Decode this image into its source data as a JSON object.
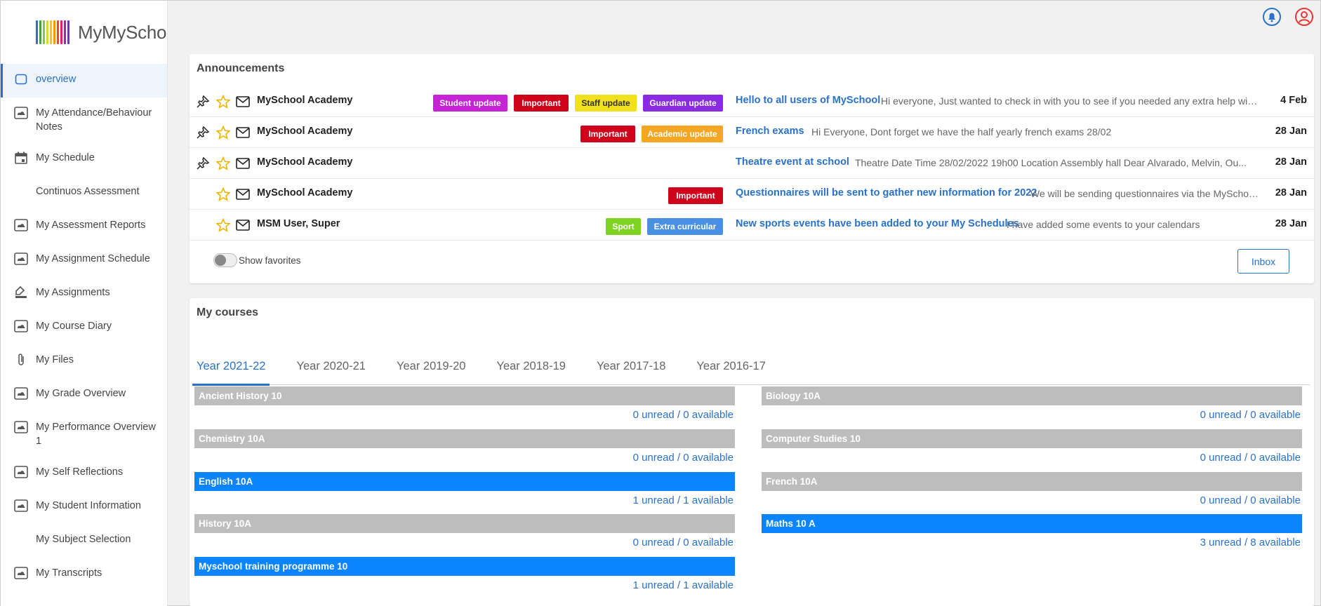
{
  "app": {
    "name": "MyMySchool",
    "logo_colors": [
      "#2a72c9",
      "#43a047",
      "#8bc34a",
      "#cddc39",
      "#ffc107",
      "#ff9800",
      "#f44336",
      "#e91e63",
      "#9c27b0",
      "#673ab7"
    ]
  },
  "sidebar": {
    "items": [
      {
        "label": "overview",
        "icon": "square-outline-icon",
        "active": true
      },
      {
        "label": "My Attendance/Behaviour Notes",
        "icon": "cloud-folder-icon"
      },
      {
        "label": "My Schedule",
        "icon": "calendar-icon"
      },
      {
        "label": "Continuos Assessment",
        "icon": ""
      },
      {
        "label": "My Assessment Reports",
        "icon": "cloud-folder-icon"
      },
      {
        "label": "My Assignment Schedule",
        "icon": "cloud-folder-icon"
      },
      {
        "label": "My Assignments",
        "icon": "pen-stamp-icon"
      },
      {
        "label": "My Course Diary",
        "icon": "cloud-folder-icon"
      },
      {
        "label": "My Files",
        "icon": "paperclip-icon"
      },
      {
        "label": "My Grade Overview",
        "icon": "cloud-folder-icon"
      },
      {
        "label": "My Performance Overview 1",
        "icon": "cloud-folder-icon"
      },
      {
        "label": "My Self Reflections",
        "icon": "cloud-folder-icon"
      },
      {
        "label": "My Student Information",
        "icon": "cloud-folder-icon"
      },
      {
        "label": "My Subject Selection",
        "icon": ""
      },
      {
        "label": "My Transcripts",
        "icon": "cloud-folder-icon"
      }
    ]
  },
  "header": {
    "icons": [
      "bell-icon",
      "user-icon"
    ],
    "accent": "#2a72c9",
    "user_color": "#e53935"
  },
  "announcements": {
    "title": "Announcements",
    "rows": [
      {
        "pinned": true,
        "sender": "MySchool Academy",
        "badges": [
          {
            "label": "Student update",
            "color": "#c623d6",
            "text": "#ffffff"
          },
          {
            "label": "Important",
            "color": "#d0021b",
            "text": "#ffffff"
          },
          {
            "label": "Staff update",
            "color": "#f1e01c",
            "text": "#333333"
          },
          {
            "label": "Guardian update",
            "color": "#8a2be2",
            "text": "#ffffff"
          }
        ],
        "subject": "Hello to all users of MySchool",
        "preview": "Hi everyone, Just wanted to check in with you to see if you needed any extra help with ...",
        "date": "4 Feb"
      },
      {
        "pinned": true,
        "sender": "MySchool Academy",
        "badges": [
          {
            "label": "Important",
            "color": "#d0021b",
            "text": "#ffffff"
          },
          {
            "label": "Academic update",
            "color": "#f5a623",
            "text": "#ffffff"
          }
        ],
        "subject": "French exams",
        "preview": "Hi Everyone,  Dont forget we have the half yearly french exams 28/02",
        "date": "28 Jan"
      },
      {
        "pinned": true,
        "sender": "MySchool Academy",
        "badges": [],
        "subject": "Theatre event at school",
        "preview": "Theatre  Date Time 28/02/2022 19h00 Location Assembly hall   Dear Alvarado, Melvin, Ou...",
        "date": "28 Jan"
      },
      {
        "pinned": false,
        "sender": "MySchool Academy",
        "badges": [
          {
            "label": "Important",
            "color": "#d0021b",
            "text": "#ffffff"
          }
        ],
        "subject": "Questionnaires will be sent to gather new information for 2022",
        "preview": "We will be sending questionnaires via the MySchoo...",
        "date": "28 Jan"
      },
      {
        "pinned": false,
        "sender": "MSM User, Super",
        "badges": [
          {
            "label": "Sport",
            "color": "#7ed321",
            "text": "#ffffff"
          },
          {
            "label": "Extra curricular",
            "color": "#4a90e2",
            "text": "#ffffff"
          }
        ],
        "subject": "New sports events have been added to your My Schedules",
        "preview": "I have added some events to your calendars",
        "date": "28 Jan"
      }
    ],
    "show_favorites_label": "Show favorites",
    "inbox_label": "Inbox"
  },
  "courses": {
    "title": "My courses",
    "tabs": [
      "Year 2021-22",
      "Year 2020-21",
      "Year 2019-20",
      "Year 2018-19",
      "Year 2017-18",
      "Year 2016-17"
    ],
    "active_tab": 0,
    "items": [
      {
        "name": "Ancient History 10",
        "count": "0 unread / 0 available",
        "highlight": false
      },
      {
        "name": "Biology 10A",
        "count": "0 unread / 0 available",
        "highlight": false
      },
      {
        "name": "Chemistry 10A",
        "count": "0 unread / 0 available",
        "highlight": false
      },
      {
        "name": "Computer Studies 10",
        "count": "0 unread / 0 available",
        "highlight": false
      },
      {
        "name": "English 10A",
        "count": "1 unread / 1 available",
        "highlight": true
      },
      {
        "name": "French 10A",
        "count": "0 unread / 0 available",
        "highlight": false
      },
      {
        "name": "History 10A",
        "count": "0 unread / 0 available",
        "highlight": false
      },
      {
        "name": "Maths 10 A",
        "count": "3 unread / 8 available",
        "highlight": true
      },
      {
        "name": "Myschool training programme 10",
        "count": "1 unread / 1 available",
        "highlight": true
      }
    ]
  }
}
